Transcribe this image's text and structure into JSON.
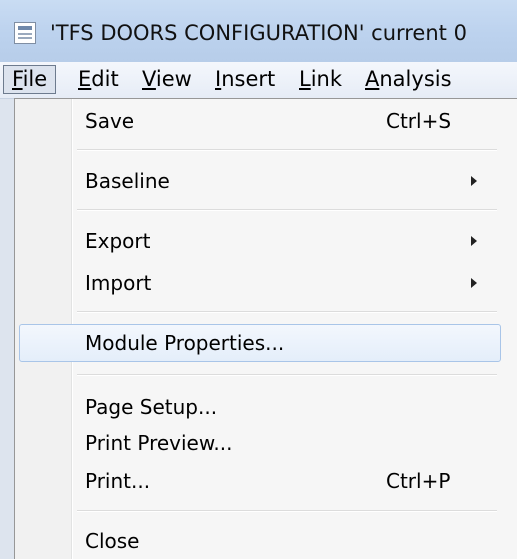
{
  "window": {
    "title": "'TFS DOORS CONFIGURATION' current 0",
    "icon": "module-document-icon"
  },
  "menubar": {
    "items": [
      {
        "label": "File",
        "mnemonic": "F",
        "rest": "ile",
        "active": true
      },
      {
        "label": "Edit",
        "mnemonic": "E",
        "rest": "dit"
      },
      {
        "label": "View",
        "mnemonic": "V",
        "rest": "iew"
      },
      {
        "label": "Insert",
        "mnemonic": "I",
        "rest": "nsert"
      },
      {
        "label": "Link",
        "mnemonic": "L",
        "rest": "ink"
      },
      {
        "label": "Analysis",
        "mnemonic": "A",
        "rest": "nalysis"
      }
    ]
  },
  "file_menu": {
    "items": [
      {
        "label": "Save",
        "shortcut": "Ctrl+S"
      },
      {
        "label": "Baseline",
        "submenu": true
      },
      {
        "label": "Export",
        "submenu": true
      },
      {
        "label": "Import",
        "submenu": true
      },
      {
        "label": "Module Properties...",
        "highlighted": true
      },
      {
        "label": "Page Setup..."
      },
      {
        "label": "Print Preview..."
      },
      {
        "label": "Print...",
        "shortcut": "Ctrl+P"
      },
      {
        "label": "Close"
      }
    ]
  }
}
